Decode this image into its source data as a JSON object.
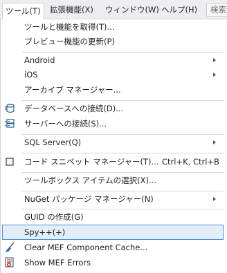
{
  "menubar": {
    "items": [
      "ツール(T)",
      "拡張機能(X)",
      "ウィンドウ(W)",
      "ヘルプ(H)"
    ],
    "search_placeholder": "検索"
  },
  "menu": {
    "items": [
      {
        "label": "ツールと機能を取得(T)..."
      },
      {
        "label": "プレビュー機能の更新(P)"
      },
      {
        "label": "Android",
        "submenu": true
      },
      {
        "label": "iOS",
        "submenu": true
      },
      {
        "label": "アーカイブ マネージャー..."
      },
      {
        "label": "データベースへの接続(D)...",
        "icon": "database-connect-icon"
      },
      {
        "label": "サーバーへの接続(S)...",
        "icon": "server-connect-icon"
      },
      {
        "label": "SQL Server(Q)",
        "submenu": true
      },
      {
        "label": "コード スニペット マネージャー(T)...",
        "shortcut": "Ctrl+K, Ctrl+B",
        "icon": "snippet-manager-icon"
      },
      {
        "label": "ツールボックス アイテムの選択(X)..."
      },
      {
        "label": "NuGet パッケージ マネージャー(N)",
        "submenu": true
      },
      {
        "label": "GUID の作成(G)"
      },
      {
        "label": "Spy++(+)",
        "highlighted": true
      },
      {
        "label": "Clear MEF Component Cache...",
        "icon": "broom-icon"
      },
      {
        "label": "Show MEF Errors",
        "icon": "error-list-icon"
      }
    ]
  }
}
